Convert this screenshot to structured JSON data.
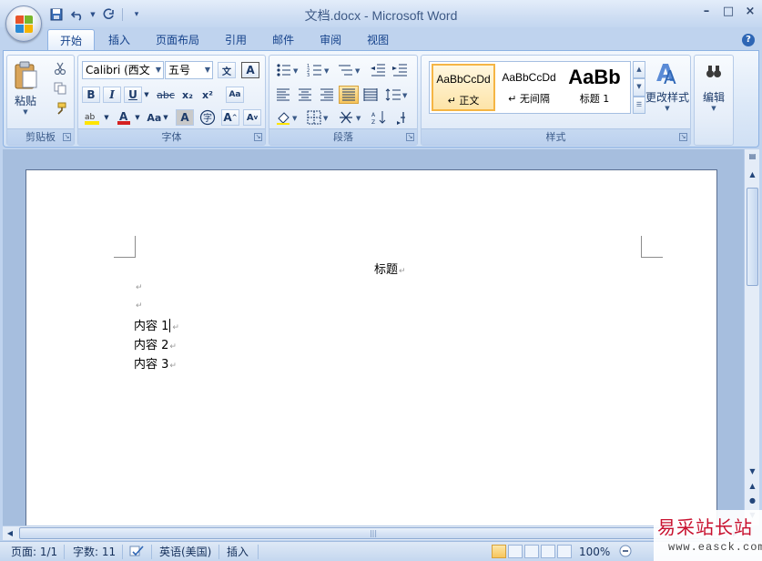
{
  "window": {
    "title": "文档.docx - Microsoft Word",
    "controls": [
      "–",
      "□",
      "×"
    ]
  },
  "quick_access": [
    "save-icon",
    "undo-icon",
    "redo-icon",
    "customize-icon"
  ],
  "tabs": [
    {
      "label": "开始",
      "active": true
    },
    {
      "label": "插入"
    },
    {
      "label": "页面布局"
    },
    {
      "label": "引用"
    },
    {
      "label": "邮件"
    },
    {
      "label": "审阅"
    },
    {
      "label": "视图"
    }
  ],
  "ribbon": {
    "clipboard": {
      "group_label": "剪贴板",
      "paste_label": "粘贴"
    },
    "font": {
      "group_label": "字体",
      "font_name": "Calibri (西文",
      "font_size": "五号",
      "bold": "B",
      "italic": "I",
      "underline": "U",
      "strike": "abc",
      "subscript": "x₂",
      "superscript": "x²",
      "change_case": "Aa",
      "font_color": "#d42020",
      "highlight_color": "#ffe400"
    },
    "paragraph": {
      "group_label": "段落"
    },
    "styles": {
      "group_label": "样式",
      "items": [
        {
          "sample": "AaBbCcDd",
          "name": "↵ 正文",
          "selected": true
        },
        {
          "sample": "AaBbCcDd",
          "name": "↵ 无间隔"
        },
        {
          "sample": "AaBb",
          "name": "标题 1"
        }
      ],
      "change_styles_label": "更改样式"
    },
    "editing": {
      "label": "编辑"
    }
  },
  "document": {
    "title_line": "标题",
    "empty_lines": [
      "↵",
      "↵"
    ],
    "content_lines": [
      "内容 1",
      "内容 2",
      "内容 3"
    ],
    "para_mark": "↵"
  },
  "status_bar": {
    "page": "页面: 1/1",
    "words": "字数: 11",
    "language": "英语(美国)",
    "mode": "插入",
    "zoom": "100%"
  },
  "watermark": {
    "text": "易采站长站",
    "url": "www.easck.com"
  },
  "colors": {
    "accent": "#15428b",
    "ribbon_bg": "#dde9f8",
    "doc_bg": "#a6bede"
  }
}
